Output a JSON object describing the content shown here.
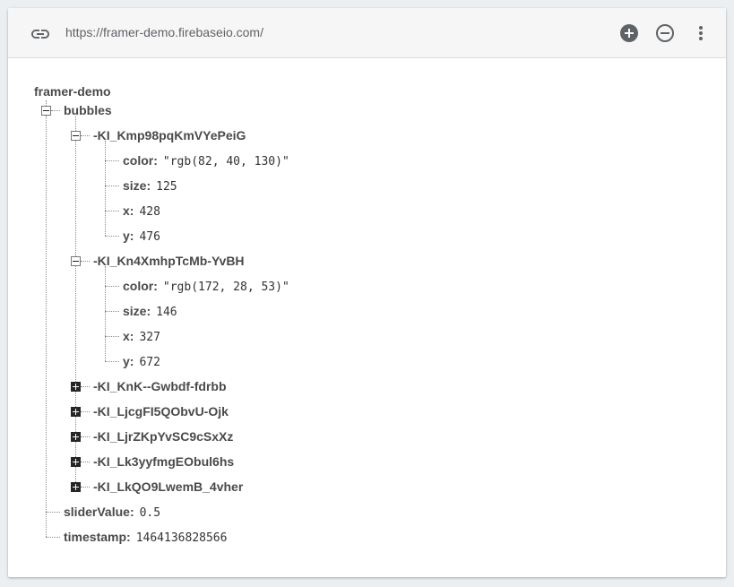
{
  "urlbar": {
    "url": "https://framer-demo.firebaseio.com/",
    "link_icon": "link-icon",
    "add_icon": "add-circle-icon",
    "remove_icon": "remove-circle-icon",
    "more_icon": "more-vert-icon"
  },
  "tree": {
    "root": "framer-demo",
    "bubbles": {
      "key": "bubbles",
      "children": [
        {
          "key": "-KI_Kmp98pqKmVYePeiG",
          "expanded": true,
          "fields": [
            {
              "key": "color",
              "value": "\"rgb(82, 40, 130)\""
            },
            {
              "key": "size",
              "value": "125"
            },
            {
              "key": "x",
              "value": "428"
            },
            {
              "key": "y",
              "value": "476"
            }
          ]
        },
        {
          "key": "-KI_Kn4XmhpTcMb-YvBH",
          "expanded": true,
          "fields": [
            {
              "key": "color",
              "value": "\"rgb(172, 28, 53)\""
            },
            {
              "key": "size",
              "value": "146"
            },
            {
              "key": "x",
              "value": "327"
            },
            {
              "key": "y",
              "value": "672"
            }
          ]
        },
        {
          "key": "-KI_KnK--Gwbdf-fdrbb",
          "expanded": false
        },
        {
          "key": "-KI_LjcgFI5QObvU-Ojk",
          "expanded": false
        },
        {
          "key": "-KI_LjrZKpYvSC9cSxXz",
          "expanded": false
        },
        {
          "key": "-KI_Lk3yyfmgEObul6hs",
          "expanded": false
        },
        {
          "key": "-KI_LkQO9LwemB_4vher",
          "expanded": false
        }
      ]
    },
    "sliderValue": {
      "key": "sliderValue",
      "value": "0.5"
    },
    "timestamp": {
      "key": "timestamp",
      "value": "1464136828566"
    }
  }
}
